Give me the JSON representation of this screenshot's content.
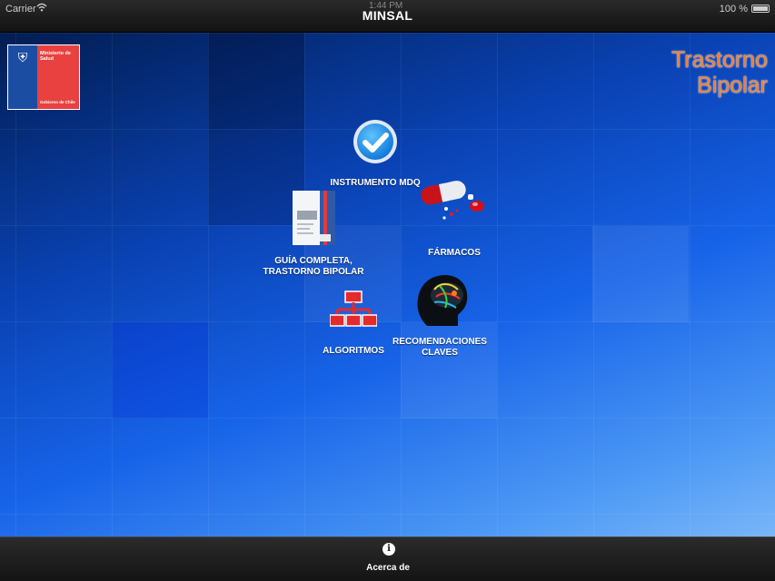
{
  "status_bar": {
    "carrier": "Carrier",
    "time": "1:44 PM",
    "battery": "100 %",
    "wifi_icon": "wifi-icon",
    "battery_icon": "battery-icon"
  },
  "nav": {
    "title": "MINSAL"
  },
  "logo": {
    "ministry": "Ministerio de Salud",
    "government": "Gobierno de Chile"
  },
  "app_title": {
    "line1": "Trastorno",
    "line2": "Bipolar"
  },
  "menu": {
    "instrumento": {
      "label": "INSTRUMENTO MDQ",
      "icon": "checkmark-icon"
    },
    "guia": {
      "line1": "GUÍA COMPLETA,",
      "line2": "TRASTORNO BIPOLAR",
      "icon": "document-icon"
    },
    "farmacos": {
      "label": "FÁRMACOS",
      "icon": "pills-icon"
    },
    "algoritmos": {
      "label": "ALGORITMOS",
      "icon": "flowchart-icon"
    },
    "recomendaciones": {
      "line1": "RECOMENDACIONES",
      "line2": "CLAVES",
      "icon": "brain-icon"
    }
  },
  "tab_bar": {
    "label": "Acerca de",
    "icon": "info-icon"
  },
  "colors": {
    "accent_title": "#f27d2e",
    "background_blue": "#1763e8",
    "nav_dark": "#1f1f1f"
  }
}
